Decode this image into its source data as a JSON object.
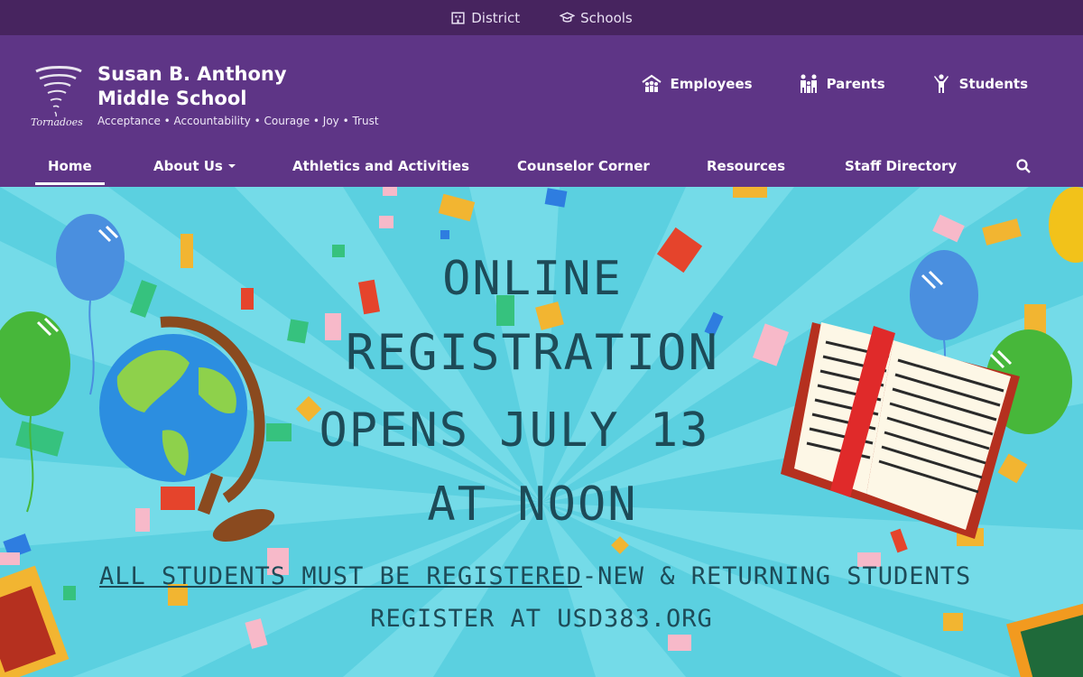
{
  "topbar": {
    "district_label": "District",
    "schools_label": "Schools"
  },
  "school": {
    "name_line1": "Susan B. Anthony",
    "name_line2": "Middle School",
    "tagline": "Acceptance • Accountability • Courage • Joy • Trust",
    "mascot": "Tornadoes"
  },
  "quicklinks": [
    {
      "label": "Employees",
      "icon": "employees-icon"
    },
    {
      "label": "Parents",
      "icon": "parents-icon"
    },
    {
      "label": "Students",
      "icon": "students-icon"
    }
  ],
  "nav": {
    "items": [
      {
        "label": "Home",
        "active": true
      },
      {
        "label": "About Us",
        "dropdown": true
      },
      {
        "label": "Athletics and Activities"
      },
      {
        "label": "Counselor Corner"
      },
      {
        "label": "Resources"
      },
      {
        "label": "Staff Directory"
      }
    ],
    "search_icon": "search-icon"
  },
  "hero": {
    "line1": "ONLINE",
    "line2": "REGISTRATION",
    "line3": "OPENS JULY 13",
    "line4": "AT NOON",
    "sub1_underlined": "ALL STUDENTS MUST BE REGISTERED",
    "sub1_rest": "-NEW & RETURNING STUDENTS",
    "sub2": "REGISTER AT USD383.ORG"
  },
  "colors": {
    "topbar": "#47245f",
    "header": "#5e3586",
    "hero_bg": "#5bd0e0",
    "hero_text": "#1d4b58"
  }
}
